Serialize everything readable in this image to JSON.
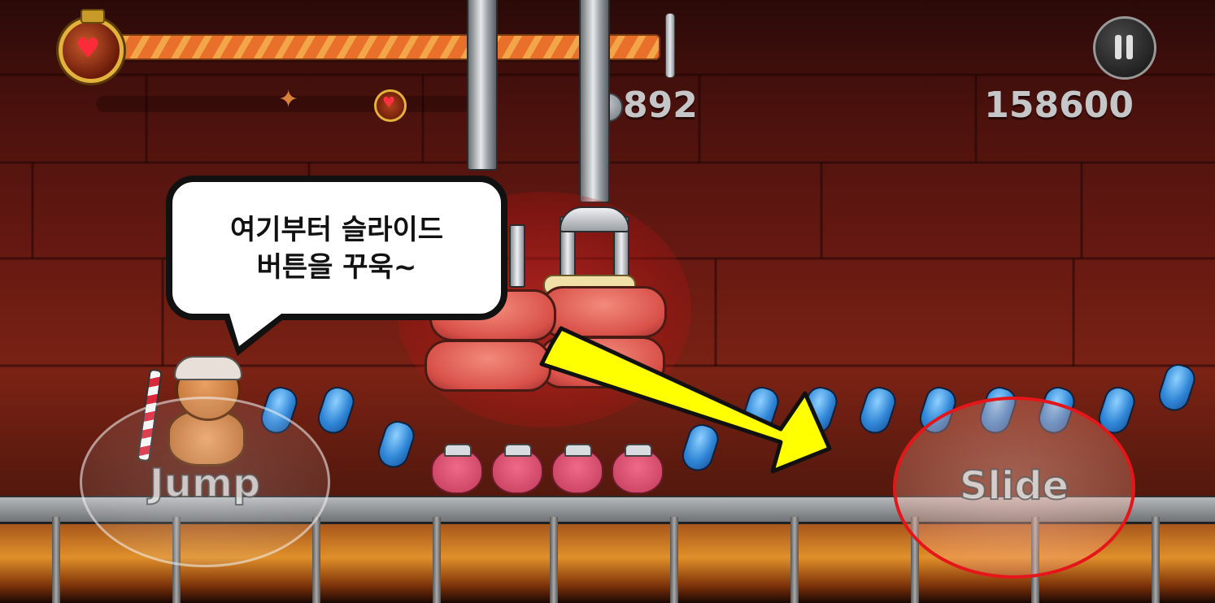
{
  "hud": {
    "coin_icon": "silver-coin-icon",
    "coins": "892",
    "score": "158600",
    "pause_icon": "pause-icon",
    "energy_icon": "heart-potion-icon",
    "energy_level": 0.98
  },
  "tutorial": {
    "bubble_line1": "여기부터 슬라이드",
    "bubble_line2": "버튼을 꾸욱~",
    "arrow_color": "#ffff00",
    "highlight_color": "#e4161a"
  },
  "controls": {
    "jump_label": "Jump",
    "slide_label": "Slide"
  },
  "colors": {
    "background": "#5a160e",
    "jelly": "#2f86d6",
    "bear_jelly": "#e05070"
  }
}
